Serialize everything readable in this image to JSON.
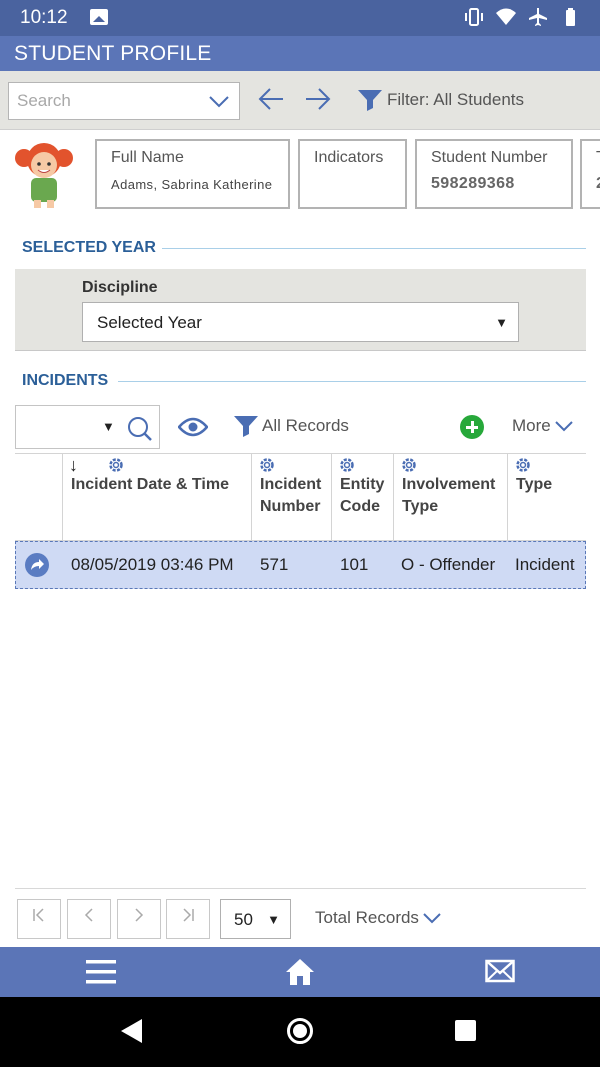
{
  "status_bar": {
    "time": "10:12"
  },
  "app": {
    "title": "STUDENT PROFILE"
  },
  "toolbar": {
    "search_placeholder": "Search",
    "filter_label": "Filter: All Students"
  },
  "profile": {
    "full_name_label": "Full Name",
    "full_name_value": "Adams, Sabrina Katherine",
    "indicators_label": "Indicators",
    "student_number_label": "Student Number",
    "student_number_value": "598289368",
    "partial_label": "T",
    "partial_value": "2"
  },
  "selected_year": {
    "heading": "SELECTED YEAR",
    "discipline_label": "Discipline",
    "discipline_value": "Selected Year"
  },
  "incidents": {
    "heading": "INCIDENTS",
    "all_records_label": "All Records",
    "more_label": "More",
    "columns": [
      {
        "label": "Incident Date & Time"
      },
      {
        "label": "Incident Number"
      },
      {
        "label": "Entity Code"
      },
      {
        "label": "Involvement Type"
      },
      {
        "label": "Type"
      }
    ],
    "rows": [
      {
        "date_time": "08/05/2019 03:46 PM",
        "incident_number": "571",
        "entity_code": "101",
        "involvement_type": "O - Offender",
        "type": "Incident"
      }
    ]
  },
  "pager": {
    "page_size": "50",
    "total_records_label": "Total Records"
  },
  "colors": {
    "header_blue": "#5b75b7",
    "status_blue": "#4a639f",
    "section_blue": "#2b5f98",
    "row_highlight": "#cfdaf4",
    "add_green": "#27a83a"
  },
  "icons": [
    "image-icon",
    "vibrate-icon",
    "wifi-icon",
    "airplane-icon",
    "battery-icon",
    "chevron-down-icon",
    "arrow-left-icon",
    "arrow-right-icon",
    "filter-icon",
    "student-avatar",
    "search-icon",
    "eye-icon",
    "add-icon",
    "gear-icon",
    "sort-down-icon",
    "row-action-icon",
    "menu-icon",
    "home-icon",
    "mail-icon"
  ]
}
